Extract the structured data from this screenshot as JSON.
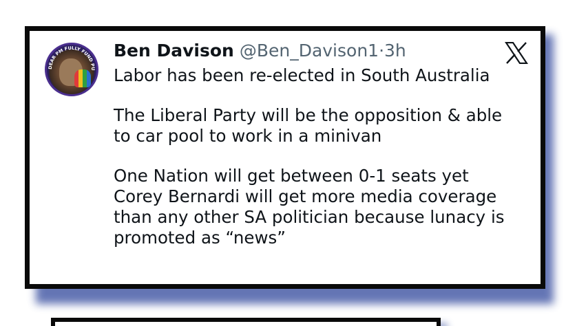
{
  "tweet": {
    "author_name": "Ben Davison",
    "handle": "@Ben_Davison1",
    "separator": "·",
    "time": "3h",
    "avatar_ring_text": "DEAR PM FULLY FUND PUBLIC SCHOOLS",
    "paragraphs": [
      "Labor has been re-elected in South Australia",
      "The Liberal Party will be the opposition & able\nto car pool to work in a minivan",
      "One Nation will get between 0-1 seats yet\nCorey Bernardi will get more media coverage\nthan any other SA politician because lunacy is\npromoted as “news”"
    ]
  },
  "platform": {
    "logo_icon": "x-logo-icon"
  },
  "colors": {
    "frame": "#0a0a0a",
    "shadow": "#4a5ea8",
    "text": "#0f1419",
    "muted": "#536471"
  }
}
